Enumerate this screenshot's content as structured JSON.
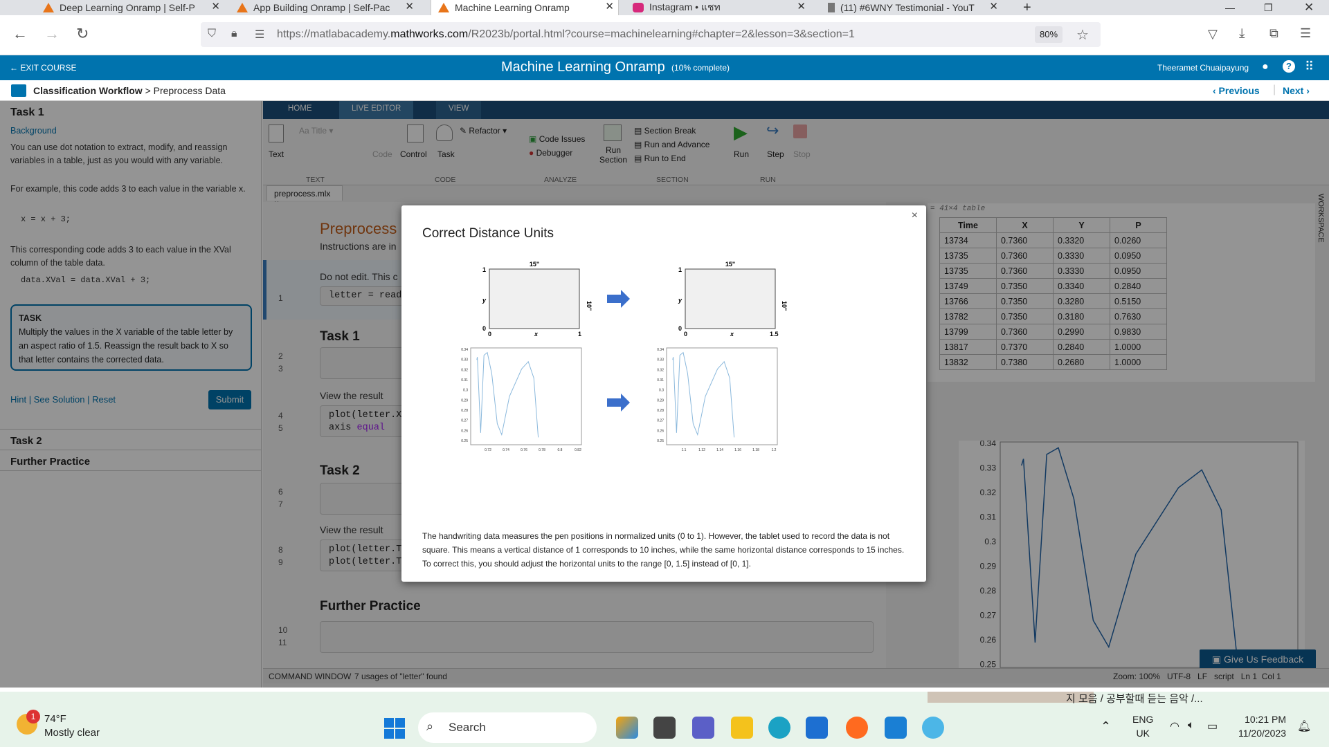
{
  "browser": {
    "tabs": [
      {
        "label": "Deep Learning Onramp | Self-P",
        "active": false
      },
      {
        "label": "App Building Onramp | Self-Pac",
        "active": false
      },
      {
        "label": "Machine Learning Onramp",
        "active": true
      },
      {
        "label": "Instagram • แชท",
        "active": false
      },
      {
        "label": "(11) #6WNY Testimonial - YouT",
        "active": false
      }
    ],
    "url_prefix": "https://matlabacademy.",
    "url_domain": "mathworks.com",
    "url_suffix": "/R2023b/portal.html?course=machinelearning#chapter=2&lesson=3&section=1",
    "zoom": "80%"
  },
  "header": {
    "exit": "EXIT COURSE",
    "title": "Machine Learning Onramp",
    "progress": "(10% complete)",
    "user": "Theeramet Chuaipayung"
  },
  "breadcrumb": {
    "section": "Classification Workflow",
    "sep": ">",
    "page": "Preprocess Data",
    "prev": "‹ Previous",
    "next": "Next ›"
  },
  "left": {
    "task_title": "Task 1",
    "background_link": "Background",
    "p1": "You can use dot notation to extract, modify, and reassign variables in a table, just as you would with any variable.",
    "p2": "For example, this code adds 3 to each value in the variable x.",
    "code1": "x = x + 3;",
    "p3": "This corresponding code adds 3 to each value in the XVal column of the table data.",
    "code2": "data.XVal = data.XVal + 3;",
    "task_label": "TASK",
    "task_text": "Multiply the values in the X variable of the table letter by an aspect ratio of 1.5. Reassign the result back to X so that letter contains the corrected data.",
    "hint": "Hint",
    "see_solution": "See Solution",
    "reset": "Reset",
    "submit": "Submit",
    "task2": "Task 2",
    "further": "Further Practice"
  },
  "matlab": {
    "tabs": [
      "HOME",
      "LIVE EDITOR",
      "VIEW"
    ],
    "ribbon": {
      "text": "Text",
      "title": "Title",
      "code": "Code",
      "control": "Control",
      "task": "Task",
      "refactor": "Refactor",
      "code_issues": "Code Issues",
      "debugger": "Debugger",
      "run_section": "Run Section",
      "section_break": "Section Break",
      "run_advance": "Run and Advance",
      "run_end": "Run to End",
      "run": "Run",
      "step": "Step",
      "stop": "Stop",
      "groups": [
        "TEXT",
        "CODE",
        "ANALYZE",
        "SECTION",
        "RUN"
      ]
    },
    "file_tab": "preprocess.mlx",
    "editor": {
      "title": "Preprocess",
      "instructions": "Instructions are in",
      "donotedit": "Do not edit. This c",
      "code_line1": "letter = read",
      "task1": "Task 1",
      "view_result1": "View the result",
      "code_line4": "plot(letter.X",
      "code_line5_kw": "axis ",
      "code_line5_arg": "equal",
      "task2": "Task 2",
      "view_result2": "View the result",
      "code_line8": "plot(letter.T",
      "code_line9": "plot(letter.T",
      "further": "Further Practice",
      "line_numbers": [
        "1",
        "2",
        "3",
        "4",
        "5",
        "6",
        "7",
        "8",
        "9",
        "10",
        "11"
      ]
    },
    "workspace": {
      "label": "= 41×4 table",
      "side_label": "WORKSPACE",
      "columns": [
        "Time",
        "X",
        "Y",
        "P"
      ],
      "rows": [
        [
          "13734",
          "0.7360",
          "0.3320",
          "0.0260"
        ],
        [
          "13735",
          "0.7360",
          "0.3330",
          "0.0950"
        ],
        [
          "13735",
          "0.7360",
          "0.3330",
          "0.0950"
        ],
        [
          "13749",
          "0.7350",
          "0.3340",
          "0.2840"
        ],
        [
          "13766",
          "0.7350",
          "0.3280",
          "0.5150"
        ],
        [
          "13782",
          "0.7350",
          "0.3180",
          "0.7630"
        ],
        [
          "13799",
          "0.7360",
          "0.2990",
          "0.9830"
        ],
        [
          "13817",
          "0.7370",
          "0.2840",
          "1.0000"
        ],
        [
          "13832",
          "0.7380",
          "0.2680",
          "1.0000"
        ]
      ]
    },
    "plot_yticks": [
      "0.34",
      "0.33",
      "0.32",
      "0.31",
      "0.3",
      "0.29",
      "0.28",
      "0.27",
      "0.26",
      "0.25"
    ],
    "feedback": "Give Us Feedback",
    "status_left": "COMMAND WINDOW",
    "status_found": "7 usages of \"letter\" found",
    "status_right": "Zoom: 100%   UTF-8   LF   script   Ln 1  Col 1"
  },
  "modal": {
    "title": "Correct Distance Units",
    "close": "×",
    "text": "The handwriting data measures the pen positions in normalized units (0 to 1). However, the tablet used to record the data is not square. This means a vertical distance of 1 corresponds to 10 inches, while the same horizontal distance corresponds to 15 inches. To correct this, you should adjust the horizontal units to the range [0, 1.5] instead of [0, 1].",
    "box_left": {
      "top": "15\"",
      "right": "10\"",
      "ylab": "y",
      "xlab": "x",
      "y1": "1",
      "y0": "0",
      "x0": "0",
      "x1": "1"
    },
    "box_right": {
      "top": "15\"",
      "right": "10\"",
      "ylab": "y",
      "xlab": "x",
      "y1": "1",
      "y0": "0",
      "x0": "0",
      "x1": "1.5"
    },
    "plot_left_xticks": [
      "0.72",
      "0.74",
      "0.76",
      "0.78",
      "0.8",
      "0.82"
    ],
    "plot_right_xticks": [
      "1.1",
      "1.12",
      "1.14",
      "1.16",
      "1.18",
      "1.2"
    ],
    "plot_yticks": [
      "0.34",
      "0.33",
      "0.32",
      "0.31",
      "0.3",
      "0.29",
      "0.28",
      "0.27",
      "0.26",
      "0.25"
    ]
  },
  "taskbar": {
    "temp": "74°F",
    "weather": "Mostly clear",
    "badge": "1",
    "search": "Search",
    "lang1": "ENG",
    "lang2": "UK",
    "time": "10:21 PM",
    "date": "11/20/2023",
    "media": "지 모음 / 공부할때 듣는 음악 /..."
  }
}
